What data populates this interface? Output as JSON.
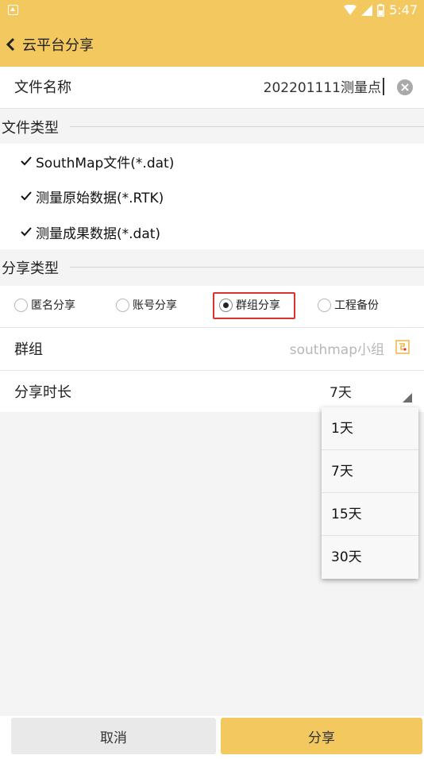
{
  "status_bar": {
    "time": "5:47"
  },
  "app_bar": {
    "title": "云平台分享"
  },
  "file_name": {
    "label": "文件名称",
    "value": "202201111测量点"
  },
  "file_type": {
    "header": "文件类型",
    "items": [
      {
        "label": "SouthMap文件(*.dat)",
        "checked": true
      },
      {
        "label": "测量原始数据(*.RTK)",
        "checked": true
      },
      {
        "label": "测量成果数据(*.dat)",
        "checked": true
      }
    ]
  },
  "share_type": {
    "header": "分享类型",
    "options": [
      {
        "label": "匿名分享",
        "selected": false
      },
      {
        "label": "账号分享",
        "selected": false
      },
      {
        "label": "群组分享",
        "selected": true
      },
      {
        "label": "工程备份",
        "selected": false
      }
    ]
  },
  "group": {
    "label": "群组",
    "value": "southmap小组"
  },
  "duration": {
    "label": "分享时长",
    "value": "7天",
    "options": [
      "1天",
      "7天",
      "15天",
      "30天"
    ]
  },
  "buttons": {
    "cancel": "取消",
    "share": "分享"
  },
  "colors": {
    "accent": "#f3c95f",
    "highlight": "#e03131"
  }
}
